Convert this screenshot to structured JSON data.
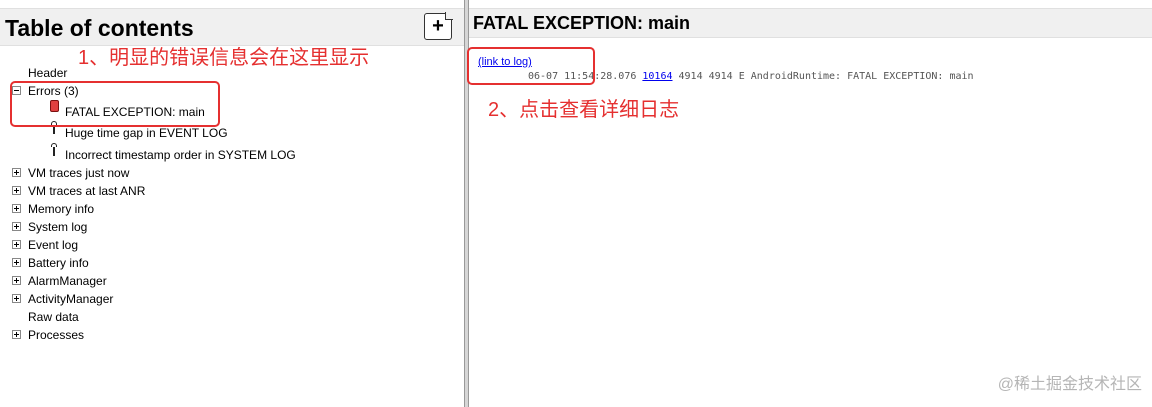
{
  "left": {
    "title": "Table of contents",
    "add_button_icon": "+",
    "tree": [
      {
        "label": "Header",
        "toggle": "none"
      },
      {
        "label": "Errors (3)",
        "toggle": "minus"
      },
      {
        "label": "FATAL EXCEPTION: main",
        "icon": "error-icon"
      },
      {
        "label": "Huge time gap in EVENT LOG",
        "icon": "warning-icon"
      },
      {
        "label": "Incorrect timestamp order in SYSTEM LOG",
        "icon": "warning-icon"
      },
      {
        "label": "VM traces just now",
        "toggle": "plus"
      },
      {
        "label": "VM traces at last ANR",
        "toggle": "plus"
      },
      {
        "label": "Memory info",
        "toggle": "plus"
      },
      {
        "label": "System log",
        "toggle": "plus"
      },
      {
        "label": "Event log",
        "toggle": "plus"
      },
      {
        "label": "Battery info",
        "toggle": "plus"
      },
      {
        "label": "AlarmManager",
        "toggle": "plus"
      },
      {
        "label": "ActivityManager",
        "toggle": "plus"
      },
      {
        "label": "Raw data",
        "toggle": "none"
      },
      {
        "label": "Processes",
        "toggle": "plus"
      }
    ]
  },
  "right": {
    "title": "FATAL EXCEPTION: main",
    "link_label": "(link to log)",
    "log_prefix": "06-07 11:54:28.076 ",
    "log_pid": "10164",
    "log_suffix": " 4914 4914 E AndroidRuntime: FATAL EXCEPTION: main"
  },
  "annotations": {
    "note1": "1、明显的错误信息会在这里显示",
    "note2": "2、点击查看详细日志",
    "color": "#e53030"
  },
  "watermark": "@稀土掘金技术社区"
}
